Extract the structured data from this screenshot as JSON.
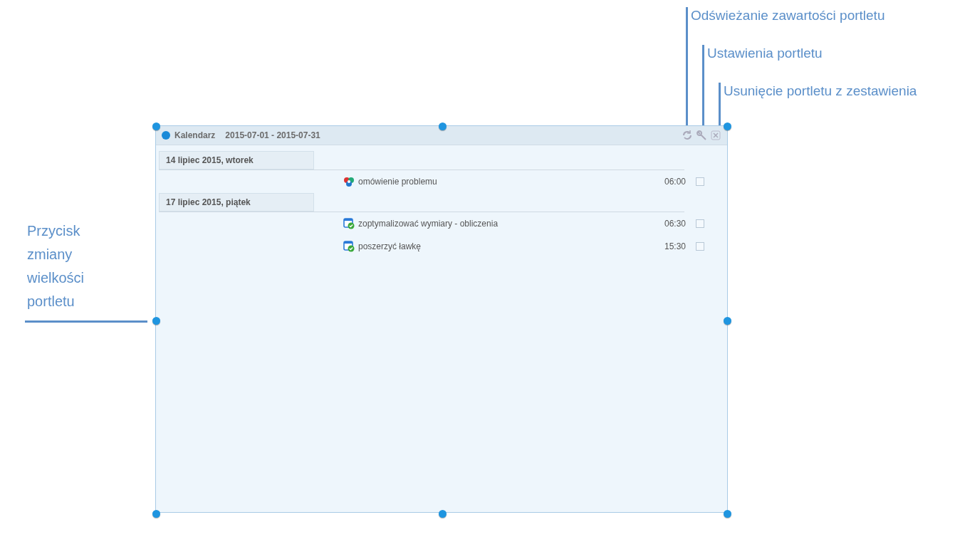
{
  "callouts": [
    {
      "text": "Odświeżanie zawartości portletu"
    },
    {
      "text": "Ustawienia portletu"
    },
    {
      "text": "Usunięcie portletu z zestawienia"
    }
  ],
  "resize_callout": {
    "text": "Przycisk zmiany wielkości portletu"
  },
  "portlet": {
    "title": "Kalendarz",
    "range": "2015-07-01 - 2015-07-31",
    "days": [
      {
        "date": "14 lipiec 2015, wtorek",
        "events": [
          {
            "kind": "meeting",
            "title": "omówienie problemu",
            "time": "06:00",
            "checked": false
          }
        ]
      },
      {
        "date": "17 lipiec 2015, piątek",
        "events": [
          {
            "kind": "task",
            "title": "zoptymalizować wymiary - obliczenia",
            "time": "06:30",
            "checked": false
          },
          {
            "kind": "task",
            "title": "poszerzyć ławkę",
            "time": "15:30",
            "checked": false
          }
        ]
      }
    ]
  }
}
